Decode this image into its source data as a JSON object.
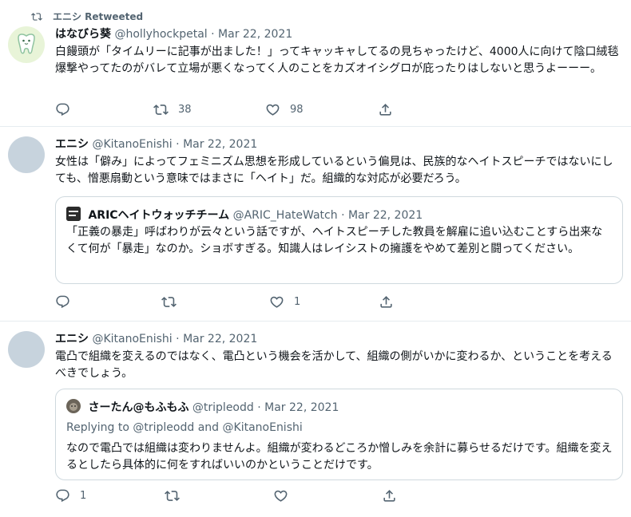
{
  "tweets": [
    {
      "retweet_label": "エニシ Retweeted",
      "name": "はなびら葵",
      "handle": "@hollyhockpetal",
      "date": "Mar 22, 2021",
      "text": "白饅頭が「タイムリーに記事が出ました！」ってキャッキャしてるの見ちゃったけど、4000人に向けて陰口絨毯爆撃やってたのがバレて立場が悪くなってく人のことをカズオイシグロが庇ったりはしないと思うよーーー。",
      "actions": {
        "reply_count": "",
        "retweet_count": "38",
        "like_count": "98"
      }
    },
    {
      "name": "エニシ",
      "handle": "@KitanoEnishi",
      "date": "Mar 22, 2021",
      "text": "女性は「僻み」によってフェミニズム思想を形成しているという偏見は、民族的なヘイトスピーチではないにしても、憎悪扇動という意味ではまさに「ヘイト」だ。組織的な対応が必要だろう。",
      "quote": {
        "name": "ARICヘイトウォッチチーム",
        "handle": "@ARIC_HateWatch",
        "date": "Mar 22, 2021",
        "avatar_text": "Hate Watch",
        "text": "「正義の暴走」呼ばわりが云々という話ですが、ヘイトスピーチした教員を解雇に追い込むことすら出来なくて何が「暴走」なのか。ショボすぎる。知識人はレイシストの擁護をやめて差別と闘ってください。"
      },
      "actions": {
        "reply_count": "",
        "retweet_count": "",
        "like_count": "1"
      }
    },
    {
      "name": "エニシ",
      "handle": "@KitanoEnishi",
      "date": "Mar 22, 2021",
      "text": "電凸で組織を変えるのではなく、電凸という機会を活かして、組織の側がいかに変わるか、ということを考えるべきでしょう。",
      "quote": {
        "name": "さーたん@もふもふ",
        "handle": "@tripleodd",
        "date": "Mar 22, 2021",
        "replying_prefix": "Replying to",
        "replying_user1": "@tripleodd",
        "replying_and": "and",
        "replying_user2": "@KitanoEnishi",
        "text": "なので電凸では組織は変わりませんよ。組織が変わるどころか憎しみを余計に募らせるだけです。組織を変えるとしたら具体的に何をすればいいのかということだけです。"
      },
      "actions": {
        "reply_count": "1",
        "retweet_count": "",
        "like_count": ""
      }
    }
  ],
  "separator": "·",
  "colors": {
    "text": "#0f1419",
    "secondary": "#536471",
    "border": "#cfd9de",
    "avatar_placeholder": "#c7d3dd",
    "avatar_tooth_bg": "#e8f4d8"
  },
  "icons": {
    "retweet": "retweet-icon",
    "reply": "reply-icon",
    "like": "heart-icon",
    "share": "share-icon"
  }
}
